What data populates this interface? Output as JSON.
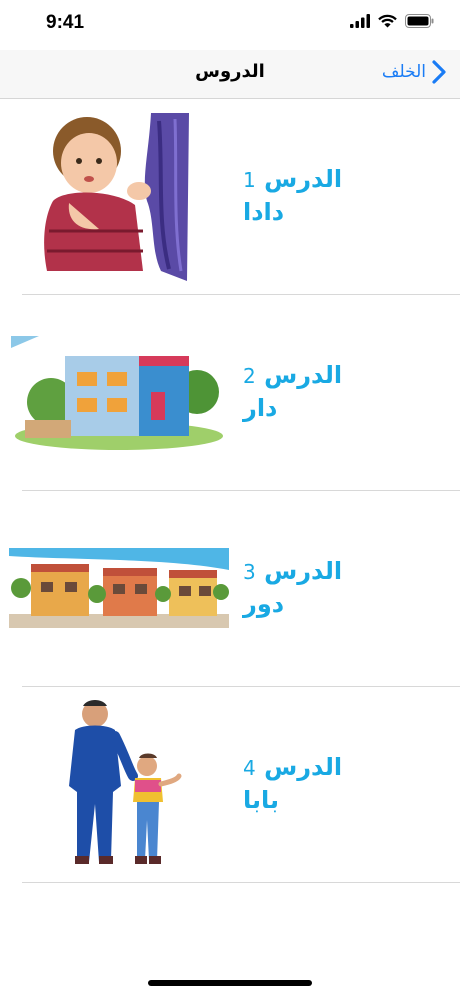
{
  "status_bar": {
    "time": "9:41"
  },
  "nav": {
    "title": "الدروس",
    "back_label": "الخلف"
  },
  "lessons": [
    {
      "heading": "الدرس",
      "number": "1",
      "word": "دادا",
      "image": "girl-at-curtain-illustration"
    },
    {
      "heading": "الدرس",
      "number": "2",
      "word": "دار",
      "image": "house-illustration"
    },
    {
      "heading": "الدرس",
      "number": "3",
      "word": "دور",
      "image": "row-of-houses-illustration"
    },
    {
      "heading": "الدرس",
      "number": "4",
      "word": "بابا",
      "image": "father-and-son-illustration"
    }
  ],
  "colors": {
    "accent": "#1a7cf5",
    "lesson_text": "#19a9e3",
    "nav_bg": "#f7f7f7",
    "divider": "#d8d8d8"
  }
}
